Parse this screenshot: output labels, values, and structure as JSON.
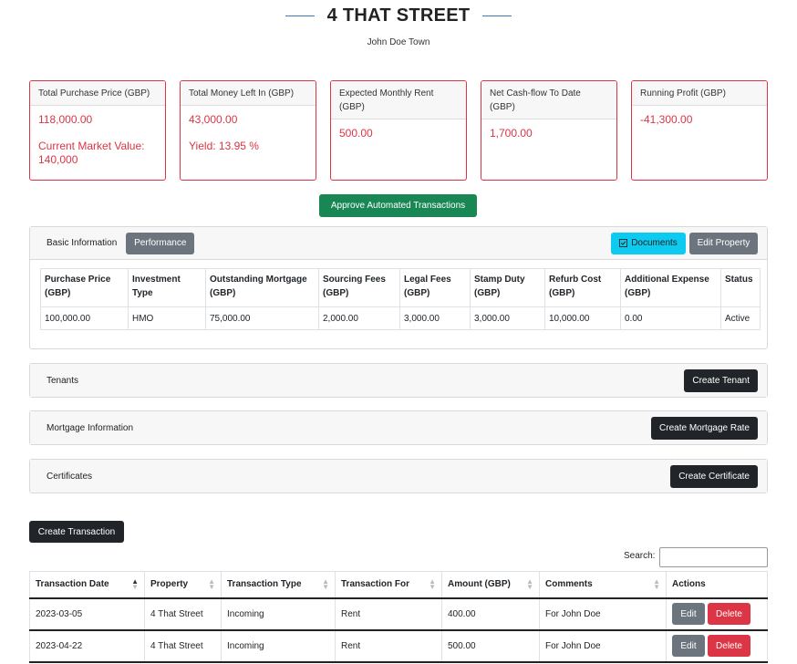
{
  "header": {
    "title": "4 THAT STREET",
    "subtitle": "John Doe Town"
  },
  "cards": [
    {
      "label": "Total Purchase Price (GBP)",
      "value": "118,000.00",
      "extra": "Current Market Value: 140,000"
    },
    {
      "label": "Total Money Left In (GBP)",
      "value": "43,000.00",
      "extra": "Yield: 13.95 %"
    },
    {
      "label": "Expected Monthly Rent (GBP)",
      "value": "500.00"
    },
    {
      "label": "Net Cash-flow To Date (GBP)",
      "value": "1,700.00"
    },
    {
      "label": "Running Profit (GBP)",
      "value": "-41,300.00"
    }
  ],
  "approve_label": "Approve Automated Transactions",
  "basic": {
    "tab_basic": "Basic Information",
    "tab_performance": "Performance",
    "documents_label": "Documents",
    "edit_label": "Edit Property",
    "columns": [
      "Purchase Price (GBP)",
      "Investment Type",
      "Outstanding Mortgage (GBP)",
      "Sourcing Fees (GBP)",
      "Legal Fees (GBP)",
      "Stamp Duty (GBP)",
      "Refurb Cost (GBP)",
      "Additional Expense (GBP)",
      "Status"
    ],
    "row": [
      "100,000.00",
      "HMO",
      "75,000.00",
      "2,000.00",
      "3,000.00",
      "3,000.00",
      "10,000.00",
      "0.00",
      "Active"
    ]
  },
  "sections": {
    "tenants": {
      "title": "Tenants",
      "button": "Create Tenant"
    },
    "mortgage": {
      "title": "Mortgage Information",
      "button": "Create Mortgage Rate"
    },
    "certificates": {
      "title": "Certificates",
      "button": "Create Certificate"
    }
  },
  "transactions": {
    "create_label": "Create Transaction",
    "search_label": "Search:",
    "search_value": "",
    "columns": [
      "Transaction Date",
      "Property",
      "Transaction Type",
      "Transaction For",
      "Amount (GBP)",
      "Comments",
      "Actions"
    ],
    "rows": [
      [
        "2023-03-05",
        "4 That Street",
        "Incoming",
        "Rent",
        "400.00",
        "For John Doe"
      ],
      [
        "2023-04-22",
        "4 That Street",
        "Incoming",
        "Rent",
        "500.00",
        "For John Doe"
      ]
    ],
    "edit_label": "Edit",
    "delete_label": "Delete"
  },
  "colors": {
    "danger": "#dc3545",
    "success": "#198754",
    "dark": "#212529",
    "secondary": "#6c757d",
    "info": "#0dcaf0"
  },
  "icons": {
    "documents": "check-square-icon"
  }
}
